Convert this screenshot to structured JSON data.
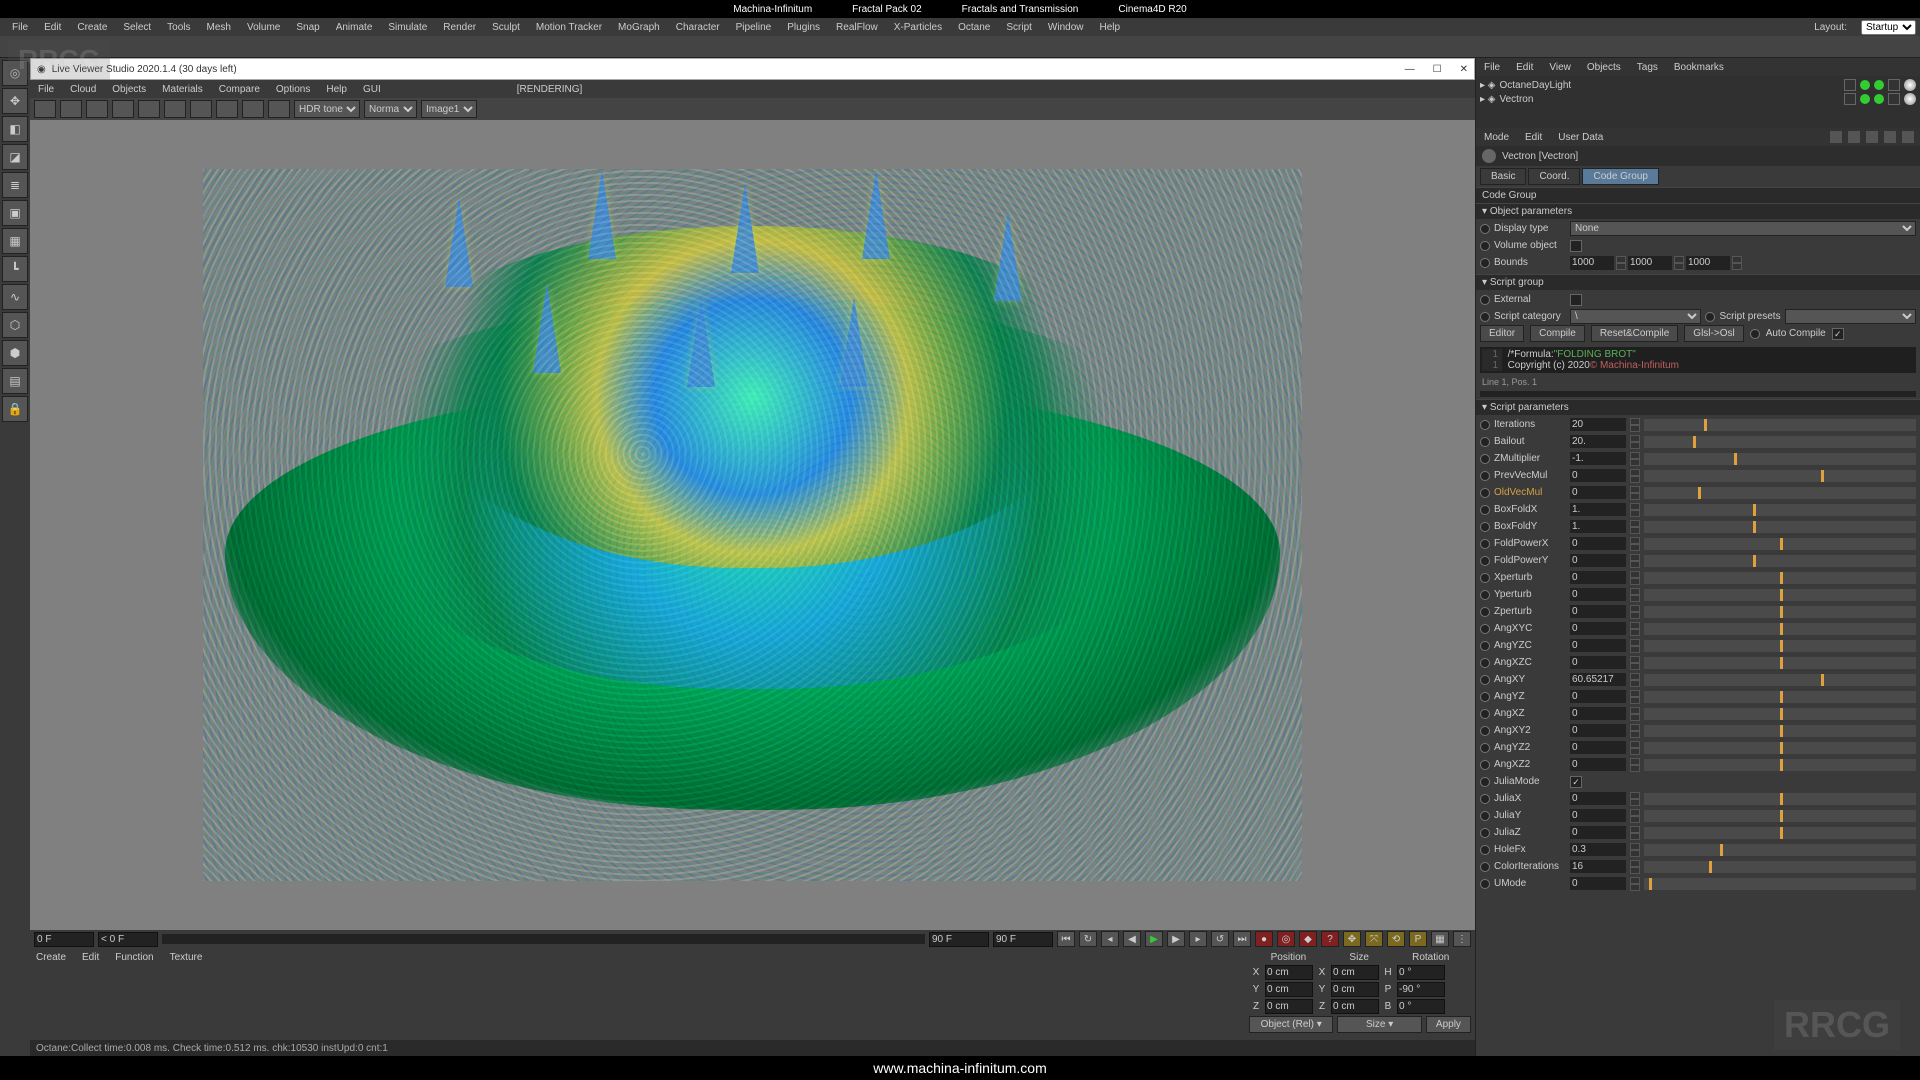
{
  "top_title": {
    "left": "Machina-Infinitum",
    "mid": "Fractal Pack 02",
    "mid2": "Fractals and Transmission",
    "right": "Cinema4D  R20"
  },
  "main_menu": [
    "File",
    "Edit",
    "Create",
    "Select",
    "Tools",
    "Mesh",
    "Volume",
    "Snap",
    "Animate",
    "Simulate",
    "Render",
    "Sculpt",
    "Motion Tracker",
    "MoGraph",
    "Character",
    "Pipeline",
    "Plugins",
    "RealFlow",
    "X-Particles",
    "Octane",
    "Script",
    "Window",
    "Help"
  ],
  "layout_label": "Layout:",
  "layout_value": "Startup",
  "viewer": {
    "title": "Live Viewer Studio 2020.1.4 (30 days left)",
    "menu": [
      "File",
      "Cloud",
      "Objects",
      "Materials",
      "Compare",
      "Options",
      "Help",
      "GUI"
    ],
    "rendering": "[RENDERING]",
    "dropdowns": {
      "tone": "HDR tone",
      "mode": "Norma",
      "image": "Image1"
    }
  },
  "timeline": {
    "frame_cur": "0 F",
    "frame_cur2": "< 0 F",
    "frame_end": "90 F",
    "frame_end2": "90 F"
  },
  "bottom_tabs": [
    "Create",
    "Edit",
    "Function",
    "Texture"
  ],
  "coord": {
    "headers": [
      "Position",
      "Size",
      "Rotation"
    ],
    "rows": [
      {
        "axis": "X",
        "pos": "0 cm",
        "size": "0 cm",
        "rlab": "H",
        "rot": "0 °"
      },
      {
        "axis": "Y",
        "pos": "0 cm",
        "size": "0 cm",
        "rlab": "P",
        "rot": "-90 °"
      },
      {
        "axis": "Z",
        "pos": "0 cm",
        "size": "0 cm",
        "rlab": "B",
        "rot": "0 °"
      }
    ],
    "mode1": "Object (Rel)",
    "mode2": "Size",
    "apply": "Apply"
  },
  "status": "Octane:Collect time:0.008 ms.  Check time:0.512 ms.  chk:10530  instUpd:0  cnt:1",
  "objmgr": {
    "menu": [
      "File",
      "Edit",
      "View",
      "Objects",
      "Tags",
      "Bookmarks"
    ],
    "items": [
      {
        "name": "OctaneDayLight"
      },
      {
        "name": "Vectron"
      }
    ]
  },
  "attr": {
    "menu": [
      "Mode",
      "Edit",
      "User Data"
    ],
    "title": "Vectron [Vectron]",
    "tabs": [
      "Basic",
      "Coord.",
      "Code Group"
    ],
    "section_codegroup": "Code Group",
    "section_objparams": "Object parameters",
    "display_type_label": "Display type",
    "display_type_value": "None",
    "volume_object_label": "Volume object",
    "bounds_label": "Bounds",
    "bounds": [
      "1000",
      "1000",
      "1000"
    ],
    "section_scriptgroup": "Script group",
    "external_label": "External",
    "script_category_label": "Script category",
    "script_presets_label": "Script presets",
    "buttons": {
      "editor": "Editor",
      "compile": "Compile",
      "reset": "Reset&Compile",
      "glsl": "Glsl->Osl",
      "auto": "Auto Compile"
    },
    "code": {
      "l1": "/*Formula:",
      "l1s": "\"FOLDING BROT\"",
      "l2": "Copyright (c) 2020 ",
      "l2s": "© Machina-Infinitum"
    },
    "code_pos": "Line 1, Pos. 1",
    "section_scriptparams": "Script parameters"
  },
  "params": [
    {
      "name": "Iterations",
      "val": "20",
      "pct": 22
    },
    {
      "name": "Bailout",
      "val": "20.",
      "pct": 18
    },
    {
      "name": "ZMultiplier",
      "val": "-1.",
      "pct": 33
    },
    {
      "name": "PrevVecMul",
      "val": "0",
      "pct": 65
    },
    {
      "name": "OldVecMul",
      "val": "0",
      "pct": 20,
      "gold": true
    },
    {
      "name": "BoxFoldX",
      "val": "1.",
      "pct": 40
    },
    {
      "name": "BoxFoldY",
      "val": "1.",
      "pct": 40
    },
    {
      "name": "FoldPowerX",
      "val": "0",
      "pct": 50
    },
    {
      "name": "FoldPowerY",
      "val": "0",
      "pct": 40
    },
    {
      "name": "Xperturb",
      "val": "0",
      "pct": 50
    },
    {
      "name": "Yperturb",
      "val": "0",
      "pct": 50
    },
    {
      "name": "Zperturb",
      "val": "0",
      "pct": 50
    },
    {
      "name": "AngXYC",
      "val": "0",
      "pct": 50
    },
    {
      "name": "AngYZC",
      "val": "0",
      "pct": 50
    },
    {
      "name": "AngXZC",
      "val": "0",
      "pct": 50
    },
    {
      "name": "AngXY",
      "val": "60.65217",
      "pct": 65
    },
    {
      "name": "AngYZ",
      "val": "0",
      "pct": 50
    },
    {
      "name": "AngXZ",
      "val": "0",
      "pct": 50
    },
    {
      "name": "AngXY2",
      "val": "0",
      "pct": 50
    },
    {
      "name": "AngYZ2",
      "val": "0",
      "pct": 50
    },
    {
      "name": "AngXZ2",
      "val": "0",
      "pct": 50
    },
    {
      "name": "JuliaMode",
      "val": "",
      "chk": true
    },
    {
      "name": "JuliaX",
      "val": "0",
      "pct": 50
    },
    {
      "name": "JuliaY",
      "val": "0",
      "pct": 50
    },
    {
      "name": "JuliaZ",
      "val": "0",
      "pct": 50
    },
    {
      "name": "HoleFx",
      "val": "0.3",
      "pct": 28
    },
    {
      "name": "ColorIterations",
      "val": "16",
      "pct": 24
    },
    {
      "name": "UMode",
      "val": "0",
      "pct": 2
    }
  ],
  "footer_url": "www.machina-infinitum.com",
  "watermark": "RRCG"
}
